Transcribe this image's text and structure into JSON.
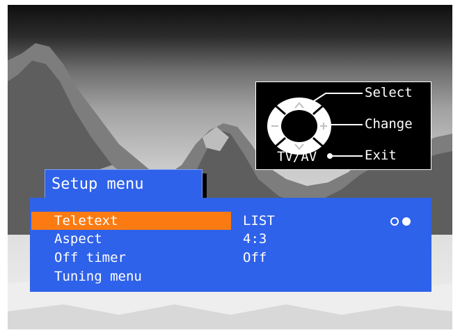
{
  "legend": {
    "select_label": "Select",
    "change_label": "Change",
    "exit_label": "Exit",
    "tvav_label": "TV/AV"
  },
  "menu": {
    "title": "Setup menu",
    "items": [
      {
        "label": "Teletext",
        "value": "LIST",
        "selected": true
      },
      {
        "label": "Aspect",
        "value": "4:3",
        "selected": false
      },
      {
        "label": "Off timer",
        "value": "Off",
        "selected": false
      },
      {
        "label": "Tuning menu",
        "value": "",
        "selected": false
      }
    ],
    "page_indicator": {
      "total": 2,
      "current": 2
    }
  },
  "colors": {
    "menu_blue": "#2f62ea",
    "highlight_orange": "#fb7b12",
    "legend_bg": "#000000"
  }
}
